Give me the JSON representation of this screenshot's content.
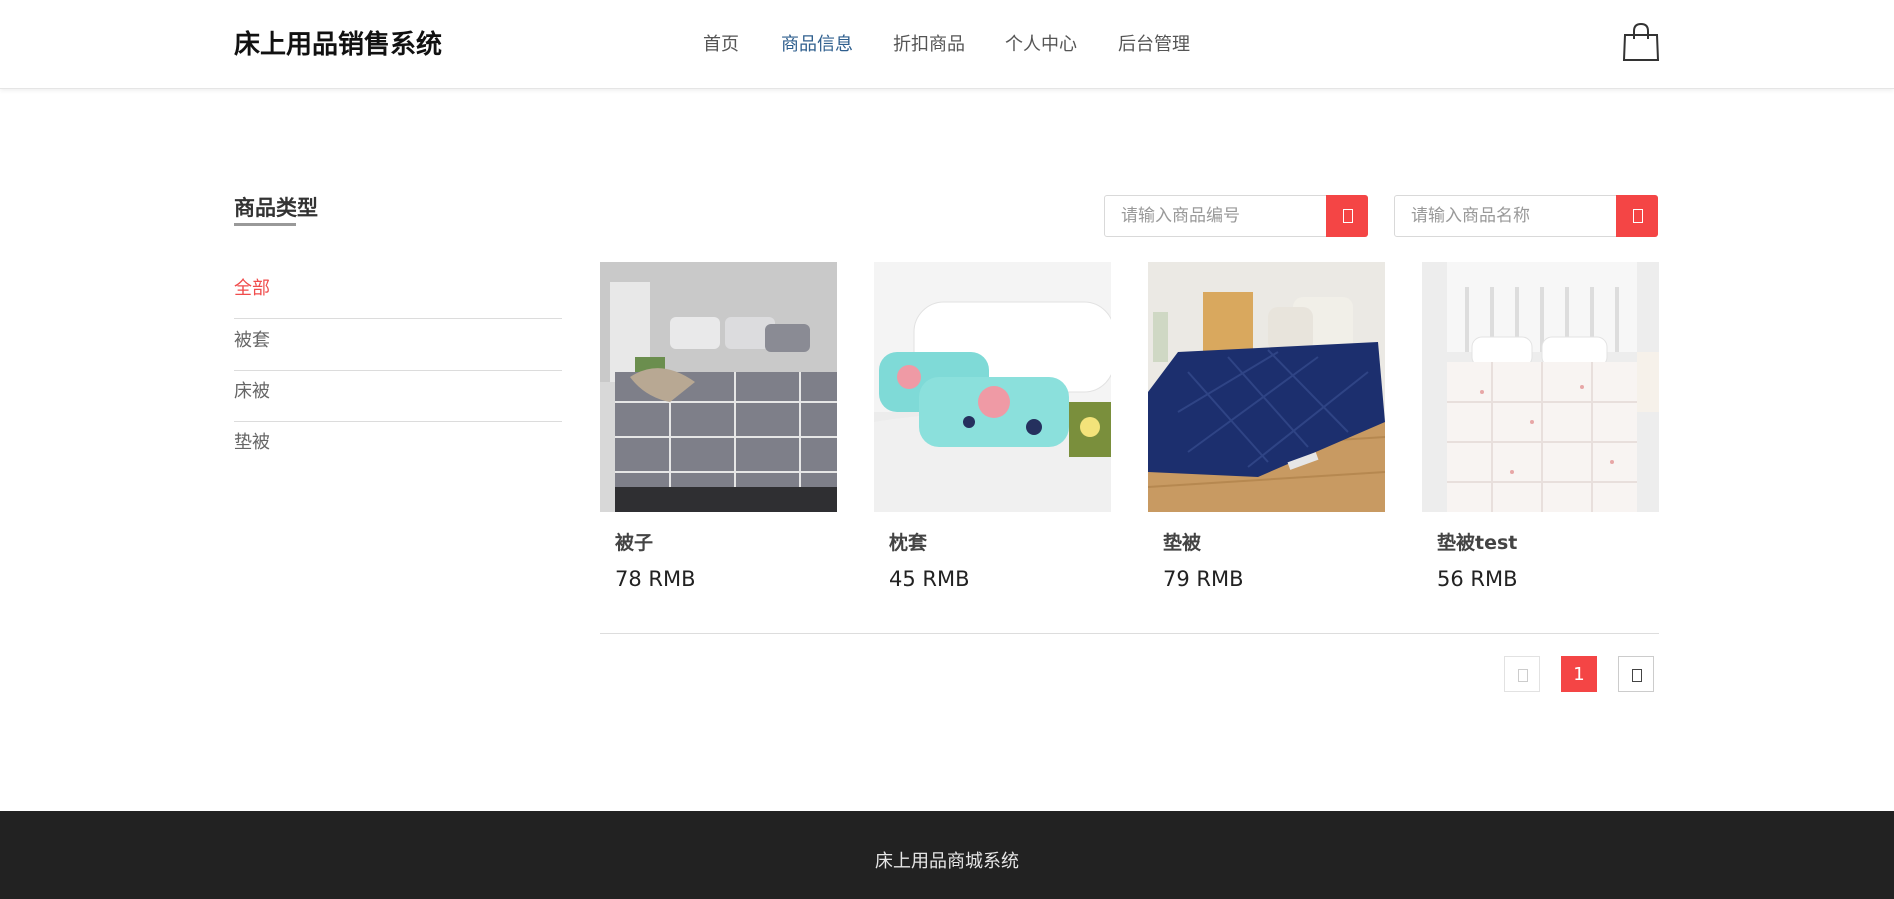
{
  "header": {
    "brand": "床上用品销售系统",
    "nav": [
      {
        "label": "首页",
        "active": false
      },
      {
        "label": "商品信息",
        "active": true
      },
      {
        "label": "折扣商品",
        "active": false
      },
      {
        "label": "个人中心",
        "active": false
      },
      {
        "label": "后台管理",
        "active": false
      }
    ],
    "cart_icon": "shopping-bag-icon"
  },
  "sidebar": {
    "title": "商品类型",
    "items": [
      {
        "label": "全部",
        "active": true
      },
      {
        "label": "被套",
        "active": false
      },
      {
        "label": "床被",
        "active": false
      },
      {
        "label": "垫被",
        "active": false
      }
    ]
  },
  "search": {
    "code_placeholder": "请输入商品编号",
    "code_value": "",
    "name_placeholder": "请输入商品名称",
    "name_value": "",
    "button_icon": "search-icon"
  },
  "products": [
    {
      "name": "被子",
      "price": "78 RMB"
    },
    {
      "name": "枕套",
      "price": "45 RMB"
    },
    {
      "name": "垫被",
      "price": "79 RMB"
    },
    {
      "name": "垫被test",
      "price": "56 RMB"
    }
  ],
  "pagination": {
    "current_page": "1",
    "prev_icon": "prev-page-icon",
    "next_icon": "next-page-icon"
  },
  "footer": {
    "text": "床上用品商城系统"
  },
  "colors": {
    "accent": "#f44545",
    "nav_active": "#2f5f8e",
    "footer_bg": "#222222"
  }
}
